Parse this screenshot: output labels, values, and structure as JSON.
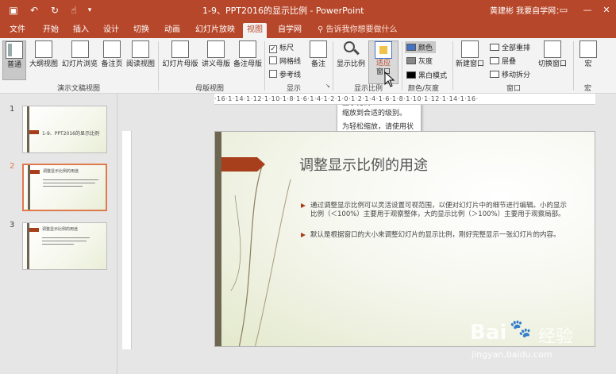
{
  "titlebar": {
    "title": "1-9、PPT2016的显示比例 - PowerPoint",
    "user": "黄建彬 我要自学网：",
    "bg": "#b7472a"
  },
  "tabs": [
    "文件",
    "开始",
    "插入",
    "设计",
    "切换",
    "动画",
    "幻灯片放映",
    "视图",
    "自学网"
  ],
  "active_tab": "视图",
  "tell_me": "告诉我你想要做什么",
  "ribbon": {
    "views": [
      "普通",
      "大纲视图",
      "幻灯片浏览",
      "备注页",
      "阅读视图"
    ],
    "views_group": "演示文稿视图",
    "masters": [
      "幻灯片母版",
      "讲义母版",
      "备注母版"
    ],
    "masters_group": "母版视图",
    "show": {
      "ruler": "标尺",
      "grid": "网格线",
      "guides": "参考线",
      "notes": "备注",
      "group": "显示"
    },
    "zoom": {
      "zoom": "显示比例",
      "fit_line1": "适应",
      "fit_line2": "窗口",
      "group": "显示比例"
    },
    "color": {
      "color": "颜色",
      "gray": "灰度",
      "bw": "黑白模式",
      "group": "颜色/灰度"
    },
    "window": {
      "new": "新建窗口",
      "arrange": "全部重排",
      "cascade": "层叠",
      "split": "移动拆分",
      "switch": "切换窗口",
      "group": "窗口"
    },
    "macro": {
      "macro": "宏",
      "group": "宏"
    }
  },
  "tooltip": {
    "title": "显示比例",
    "desc": "缩放到合适的级别。",
    "hint": "为轻松缩放，请使用状态栏中的控件。"
  },
  "ruler_text": "·16·1·14·1·12·1·10·1·8·1·6·1·4·1·2·1·0·1·2·1·4·1·6·1·8·1·10·1·12·1·14·1·16·",
  "thumbnails": [
    {
      "num": "1",
      "title": "1-9、PPT2016的显示比例"
    },
    {
      "num": "2",
      "title": "调整显示比例的用途"
    },
    {
      "num": "3",
      "title": "调整显示比例的用途"
    }
  ],
  "slide": {
    "title": "调整显示比例的用途",
    "bullet1": "通过调整显示比例可以灵活设置可视范围，以便对幻灯片中的细节进行编辑。小的显示比例（＜100%）主要用于观察整体，大的显示比例（＞100%）主要用于观察局部。",
    "bullet2": "默认是根据窗口的大小来调整幻灯片的显示比例，刚好完整显示一张幻灯片的内容。"
  },
  "watermark": {
    "brand": "Bai",
    "brand2": "经验",
    "url": "jingyan.baidu.com"
  }
}
